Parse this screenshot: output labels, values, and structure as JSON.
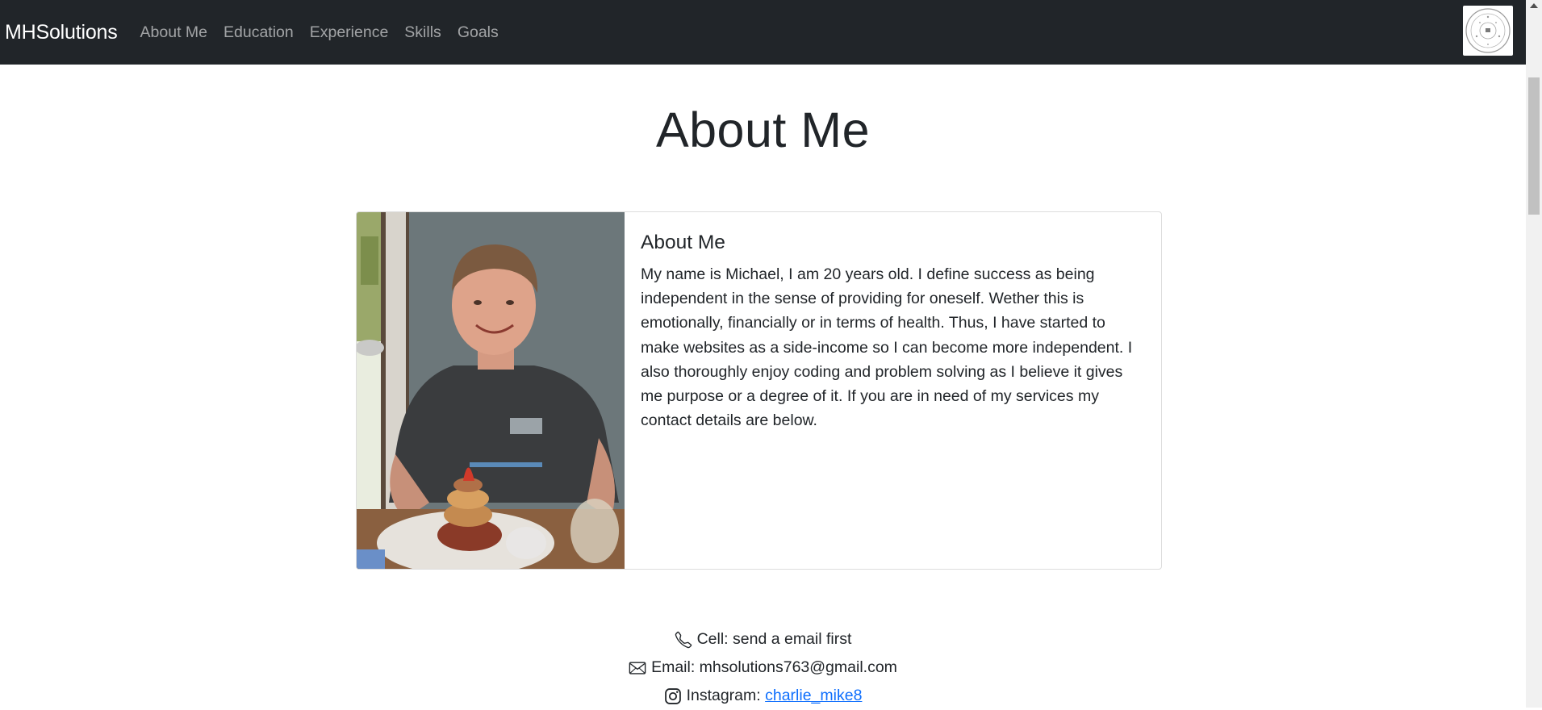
{
  "navbar": {
    "brand": "MHSolutions",
    "links": [
      {
        "label": "About Me"
      },
      {
        "label": "Education"
      },
      {
        "label": "Experience"
      },
      {
        "label": "Skills"
      },
      {
        "label": "Goals"
      }
    ],
    "logo_icon": "seal-logo-icon"
  },
  "page": {
    "title": "About Me"
  },
  "card": {
    "image_icon": "profile-photo",
    "title": "About Me",
    "text": "My name is Michael, I am 20 years old. I define success as being independent in the sense of providing for oneself. Wether this is emotionally, financially or in terms of health. Thus, I have started to make websites as a side-income so I can become more independent. I also thoroughly enjoy coding and problem solving as I believe it gives me purpose or a degree of it. If you are in need of my services my contact details are below."
  },
  "contact": {
    "cell_label": "Cell: send a email first",
    "email_label": "Email: mhsolutions763@gmail.com",
    "instagram_label": "Instagram:",
    "instagram_handle": "charlie_mike8",
    "icons": [
      "phone-icon",
      "envelope-icon",
      "instagram-icon"
    ]
  },
  "colors": {
    "navbar_bg": "#212529",
    "link": "#0d6efd",
    "text": "#212529"
  }
}
